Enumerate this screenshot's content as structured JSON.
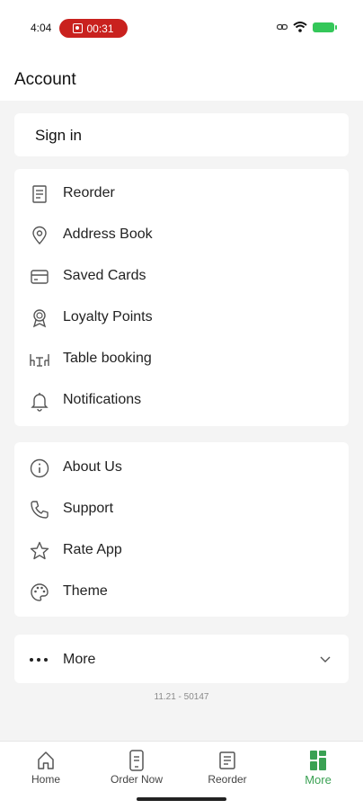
{
  "status": {
    "time": "4:04",
    "recording": "00:31"
  },
  "header": {
    "title": "Account"
  },
  "signin": {
    "label": "Sign in"
  },
  "menu1": {
    "items": [
      {
        "label": "Reorder",
        "icon": "receipt-icon"
      },
      {
        "label": "Address Book",
        "icon": "location-pin-icon"
      },
      {
        "label": "Saved Cards",
        "icon": "credit-card-icon"
      },
      {
        "label": "Loyalty Points",
        "icon": "award-ribbon-icon"
      },
      {
        "label": "Table booking",
        "icon": "table-chairs-icon"
      },
      {
        "label": "Notifications",
        "icon": "bell-icon"
      }
    ]
  },
  "menu2": {
    "items": [
      {
        "label": "About Us",
        "icon": "info-icon"
      },
      {
        "label": "Support",
        "icon": "phone-icon"
      },
      {
        "label": "Rate App",
        "icon": "star-icon"
      },
      {
        "label": "Theme",
        "icon": "palette-icon"
      }
    ]
  },
  "more": {
    "label": "More"
  },
  "version": "11.21 - 50147",
  "tabs": [
    {
      "label": "Home",
      "icon": "home-icon"
    },
    {
      "label": "Order Now",
      "icon": "order-phone-icon"
    },
    {
      "label": "Reorder",
      "icon": "receipt-icon"
    },
    {
      "label": "More",
      "icon": "grid-icon"
    }
  ],
  "colors": {
    "accent": "#3aa153",
    "recording": "#c9211e"
  }
}
